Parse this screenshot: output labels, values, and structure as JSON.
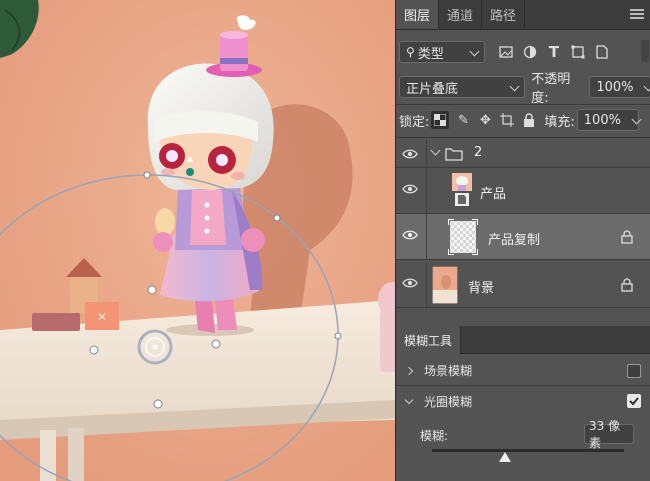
{
  "tabs": [
    "图层",
    "通道",
    "路径"
  ],
  "filter": {
    "label": "类型"
  },
  "blend_mode": "正片叠底",
  "opacity": {
    "label": "不透明度:",
    "value": "100%"
  },
  "lock": {
    "label": "锁定:"
  },
  "fill": {
    "label": "填充:",
    "value": "100%"
  },
  "layers": [
    {
      "name": "2",
      "type": "group"
    },
    {
      "name": "产品",
      "type": "smart"
    },
    {
      "name": "产品复制",
      "type": "layer",
      "selected": true,
      "locked": true
    },
    {
      "name": "背景",
      "type": "layer",
      "locked": true
    }
  ],
  "blur_panel": {
    "title": "模糊工具",
    "options": [
      {
        "name": "场景模糊",
        "checked": false,
        "expanded": false
      },
      {
        "name": "光圈模糊",
        "checked": true,
        "expanded": true
      }
    ],
    "blur_label": "模糊:",
    "blur_value": "33 像素",
    "blur_fraction": 0.38
  },
  "colors": {
    "panel": "#535353",
    "tabbar": "#3c3c3c",
    "selected": "#6b6b6b",
    "wall": "#e9a98a"
  }
}
